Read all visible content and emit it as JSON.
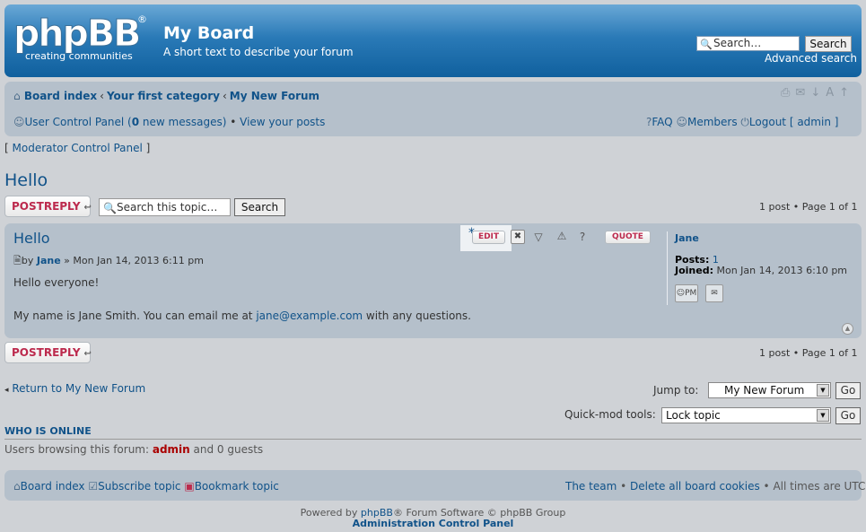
{
  "header": {
    "logo_text": "phpBB",
    "logo_reg": "®",
    "logo_tagline": "creating   communities",
    "site_name": "My Board",
    "site_description": "A short text to describe your forum",
    "search_placeholder": "Search…",
    "search_button": "Search",
    "advanced_search": "Advanced search"
  },
  "breadcrumbs": [
    "Board index",
    "Your first category",
    "My New Forum"
  ],
  "breadcrumb_sep": "‹",
  "user_links": {
    "ucp_prefix": "User Control Panel (",
    "new_count": "0",
    "ucp_suffix": " new messages)",
    "bullet": " • ",
    "view_posts": "View your posts",
    "faq": "FAQ",
    "members": "Members",
    "logout": "Logout [ admin ]"
  },
  "moderator_panel": {
    "open": "[ ",
    "label": "Moderator Control Panel",
    "close": " ]"
  },
  "topic": {
    "title": "Hello",
    "reply_label": "POSTREPLY",
    "search_placeholder": "Search this topic…",
    "search_button": "Search",
    "pagination": "1 post • Page 1 of 1"
  },
  "post": {
    "title": "Hello",
    "by": "by ",
    "author": "Jane",
    "date": " » Mon Jan 14, 2013 6:11 pm",
    "line1": "Hello everyone!",
    "line2_prefix": "My name is Jane Smith. You can email me at ",
    "email": "jane@example.com",
    "line2_suffix": " with any questions.",
    "edit_label": "EDIT",
    "quote_label": "QUOTE",
    "profile": {
      "name": "Jane",
      "posts_label": "Posts:",
      "posts_value": " 1",
      "joined_label": "Joined:",
      "joined_value": " Mon Jan 14, 2013 6:10 pm",
      "pm_label": "PM"
    }
  },
  "bottom": {
    "return_link": "Return to My New Forum",
    "jump_to_label": "Jump to:",
    "jump_to_value": "My New Forum",
    "quickmod_label": "Quick-mod tools:",
    "quickmod_value": "Lock topic",
    "go": "Go"
  },
  "online": {
    "heading": "WHO IS ONLINE",
    "text_prefix": "Users browsing this forum: ",
    "user": "admin",
    "text_suffix": " and 0 guests"
  },
  "footer": {
    "board_index": "Board index",
    "subscribe": "Subscribe topic",
    "bookmark": "Bookmark topic",
    "team": "The team",
    "delete_cookies": "Delete all board cookies",
    "timezone": "All times are UTC",
    "bullet": " • ",
    "powered_prefix": "Powered by ",
    "powered_brand": "phpBB",
    "powered_suffix": "® Forum Software © phpBB Group",
    "acp": "Administration Control Panel"
  },
  "colors": {
    "link": "#105289",
    "accent_red": "#bc2a4d",
    "header_blue": "#10609e",
    "panel": "#b5c0cb"
  },
  "icons": [
    "home-icon",
    "print-icon",
    "email-icon",
    "font-size-icon",
    "user-icon",
    "faq-icon",
    "members-icon",
    "power-icon",
    "search-icon",
    "post-icon",
    "delete-icon",
    "report-icon",
    "warn-icon",
    "info-icon",
    "pm-icon",
    "top-icon",
    "subscribe-icon",
    "bookmark-icon"
  ]
}
